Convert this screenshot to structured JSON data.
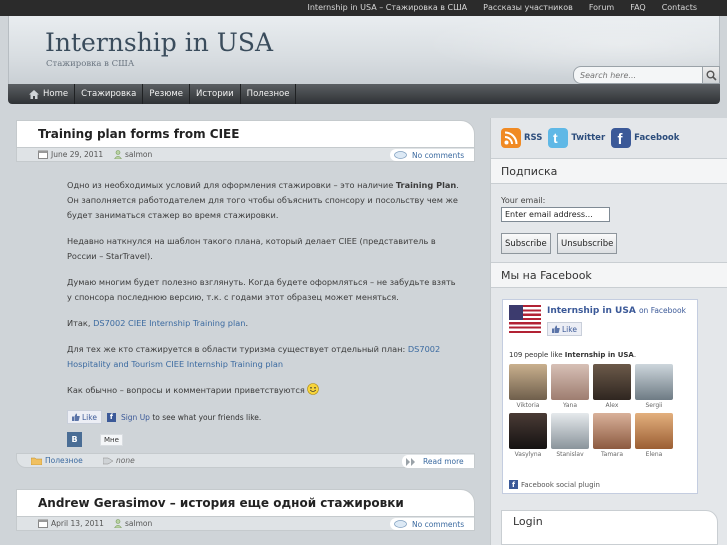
{
  "topnav": [
    "Internship in USA – Стажировка в США",
    "Рассказы участников",
    "Forum",
    "FAQ",
    "Contacts"
  ],
  "header": {
    "title": "Internship in USA",
    "subtitle": "Стажировка в США",
    "search_placeholder": "Search here..."
  },
  "mainnav": [
    "Home",
    "Стажировка",
    "Резюме",
    "Истории",
    "Полезное"
  ],
  "post1": {
    "title": "Training plan forms from CIEE",
    "date": "June 29, 2011",
    "author": "salmon",
    "comments": "No comments",
    "p1_before": "Одно из необходимых условий для оформления стажировки – это наличие ",
    "p1_bold": "Training Plan",
    "p1_after": ". Он заполняется работодателем для того чтобы объяснить спонсору и посольству чем же будет заниматься стажер во время стажировки.",
    "p2": "Недавно наткнулся на шаблон такого плана, который делает CIEE (представитель в России – StarTravel).",
    "p3": "Думаю многим будет полезно взглянуть. Когда будете оформляться – не забудьте взять у спонсора последнюю версию, т.к. с годами этот образец может меняться.",
    "p4_before": "Итак, ",
    "p4_link": "DS7002 CIEE Internship Training plan",
    "p4_after": ".",
    "p5_before": "Для тех же кто стажируется в области туризма существует отдельный план: ",
    "p5_link": "DS7002 Hospitality and Tourism CIEE Internship Training plan",
    "p6": "Как обычно – вопросы и комментарии приветствуются",
    "fb_like": "Like",
    "fb_signup": "Sign Up",
    "fb_signup_rest": " to see what your friends like.",
    "vk_letter": "В",
    "vk_mne": "Мне",
    "category": "Полезное",
    "tags": "none",
    "readmore": "Read more"
  },
  "post2": {
    "title": "Andrew Gerasimov – история еще одной стажировки",
    "date": "April 13, 2011",
    "author": "salmon",
    "comments": "No comments"
  },
  "sidebar": {
    "rss": "RSS",
    "twitter": "Twitter",
    "facebook": "Facebook",
    "subscribe_heading": "Подписка",
    "email_label": "Your email:",
    "email_value": "Enter email address...",
    "subscribe_btn": "Subscribe",
    "unsubscribe_btn": "Unsubscribe",
    "fb_heading": "Мы на Facebook",
    "fb_page_name": "Internship in USA",
    "fb_on": "on Facebook",
    "fb_like": "Like",
    "fb_count_pre": "109 people like ",
    "fb_count_name": "Internship in USA",
    "fb_count_post": ".",
    "faces": [
      {
        "name": "Viktoria",
        "color": "#8a7a66"
      },
      {
        "name": "Yana",
        "color": "#b59a8c"
      },
      {
        "name": "Alex",
        "color": "#54463a"
      },
      {
        "name": "Sergii",
        "color": "#9aa6ae"
      },
      {
        "name": "Vasylyna",
        "color": "#2b2523"
      },
      {
        "name": "Stanislav",
        "color": "#a7aeb3"
      },
      {
        "name": "Tamara",
        "color": "#b2826a"
      },
      {
        "name": "Elena",
        "color": "#c48a5a"
      }
    ],
    "fb_plugin": "Facebook social plugin",
    "login_heading": "Login"
  }
}
